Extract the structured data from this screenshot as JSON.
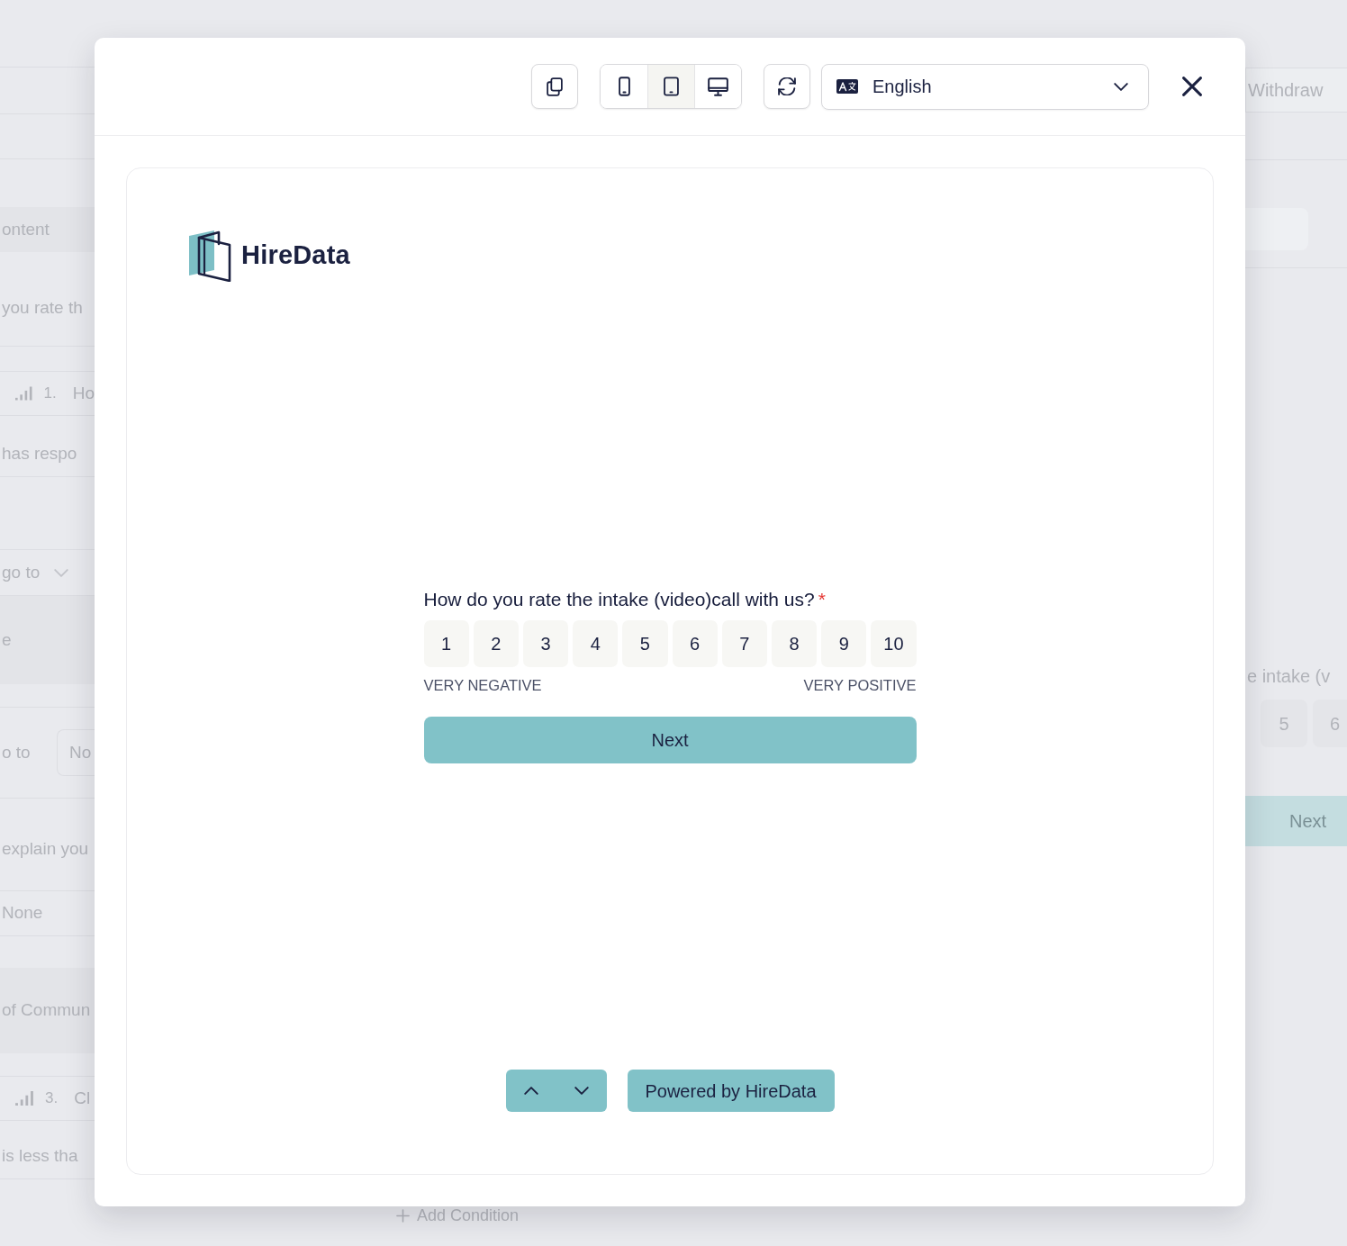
{
  "background": {
    "left_rows": [
      {
        "kind": "text",
        "text": "ontent"
      },
      {
        "kind": "text",
        "text": "you rate th"
      },
      {
        "kind": "question",
        "number": "1.",
        "title": "Ho"
      },
      {
        "kind": "text",
        "text": "has respo"
      },
      {
        "kind": "select",
        "text": "go to"
      },
      {
        "kind": "text",
        "text": "e"
      },
      {
        "kind": "field_row",
        "label": "o to",
        "value": "No"
      },
      {
        "kind": "text",
        "text": "explain you"
      },
      {
        "kind": "field",
        "value": "None"
      },
      {
        "kind": "text",
        "text": "of Commun"
      },
      {
        "kind": "question",
        "number": "3.",
        "title": "Cl"
      },
      {
        "kind": "text",
        "text": "is less tha"
      }
    ],
    "withdraw_button": "Withdraw",
    "question_fragment": "e intake (v",
    "rating_fragment": [
      {
        "label": "5"
      },
      {
        "label": "6"
      }
    ],
    "next_button": "Next",
    "add_condition": "Add Condition"
  },
  "dialog": {
    "toolbar": {
      "devices": [
        {
          "kind": "phone",
          "selected": false
        },
        {
          "kind": "tablet",
          "selected": true
        },
        {
          "kind": "desktop",
          "selected": false
        }
      ],
      "language": "English"
    },
    "survey": {
      "brand": "HireData",
      "question": "How do you rate the intake (video)call with us?",
      "required_mark": "*",
      "options": [
        {
          "label": "1",
          "selected": false
        },
        {
          "label": "2",
          "selected": false
        },
        {
          "label": "3",
          "selected": false
        },
        {
          "label": "4",
          "selected": false
        },
        {
          "label": "5",
          "selected": false
        },
        {
          "label": "6",
          "selected": false
        },
        {
          "label": "7",
          "selected": false
        },
        {
          "label": "8",
          "selected": false
        },
        {
          "label": "9",
          "selected": false
        },
        {
          "label": "10",
          "selected": false
        }
      ],
      "min_label": "VERY NEGATIVE",
      "max_label": "VERY POSITIVE",
      "next_button": "Next",
      "powered_by": "Powered by HireData"
    }
  }
}
